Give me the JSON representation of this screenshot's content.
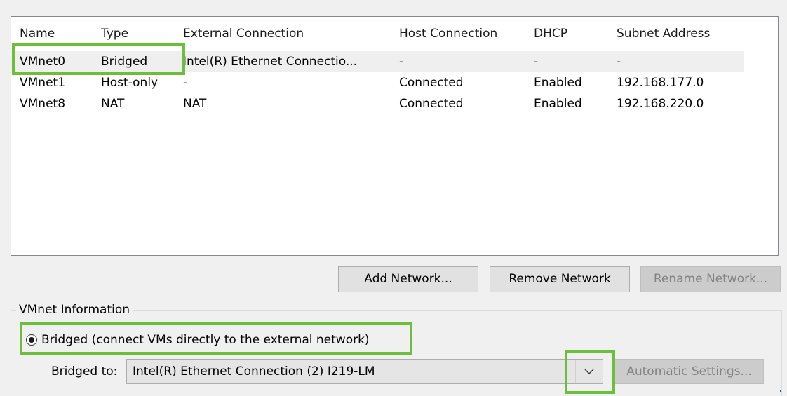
{
  "columns": [
    "Name",
    "Type",
    "External Connection",
    "Host Connection",
    "DHCP",
    "Subnet Address"
  ],
  "rows": [
    [
      "VMnet0",
      "Bridged",
      "Intel(R) Ethernet Connectio...",
      "-",
      "-",
      "-"
    ],
    [
      "VMnet1",
      "Host-only",
      "-",
      "Connected",
      "Enabled",
      "192.168.177.0"
    ],
    [
      "VMnet8",
      "NAT",
      "NAT",
      "Connected",
      "Enabled",
      "192.168.220.0"
    ]
  ],
  "buttons": {
    "add": "Add Network...",
    "remove": "Remove Network",
    "rename": "Rename Network..."
  },
  "vmnet_info": {
    "group_label": "VMnet Information",
    "bridged_radio": "Bridged (connect VMs directly to the external network)",
    "bridged_to_label": "Bridged to:",
    "bridged_to_value": "Intel(R) Ethernet Connection (2) I219-LM",
    "automatic_settings": "Automatic Settings..."
  },
  "colors": {
    "highlight": "#6bbf3b",
    "selected_row": "#efeff0",
    "window_bg": "#f0f0f0"
  }
}
